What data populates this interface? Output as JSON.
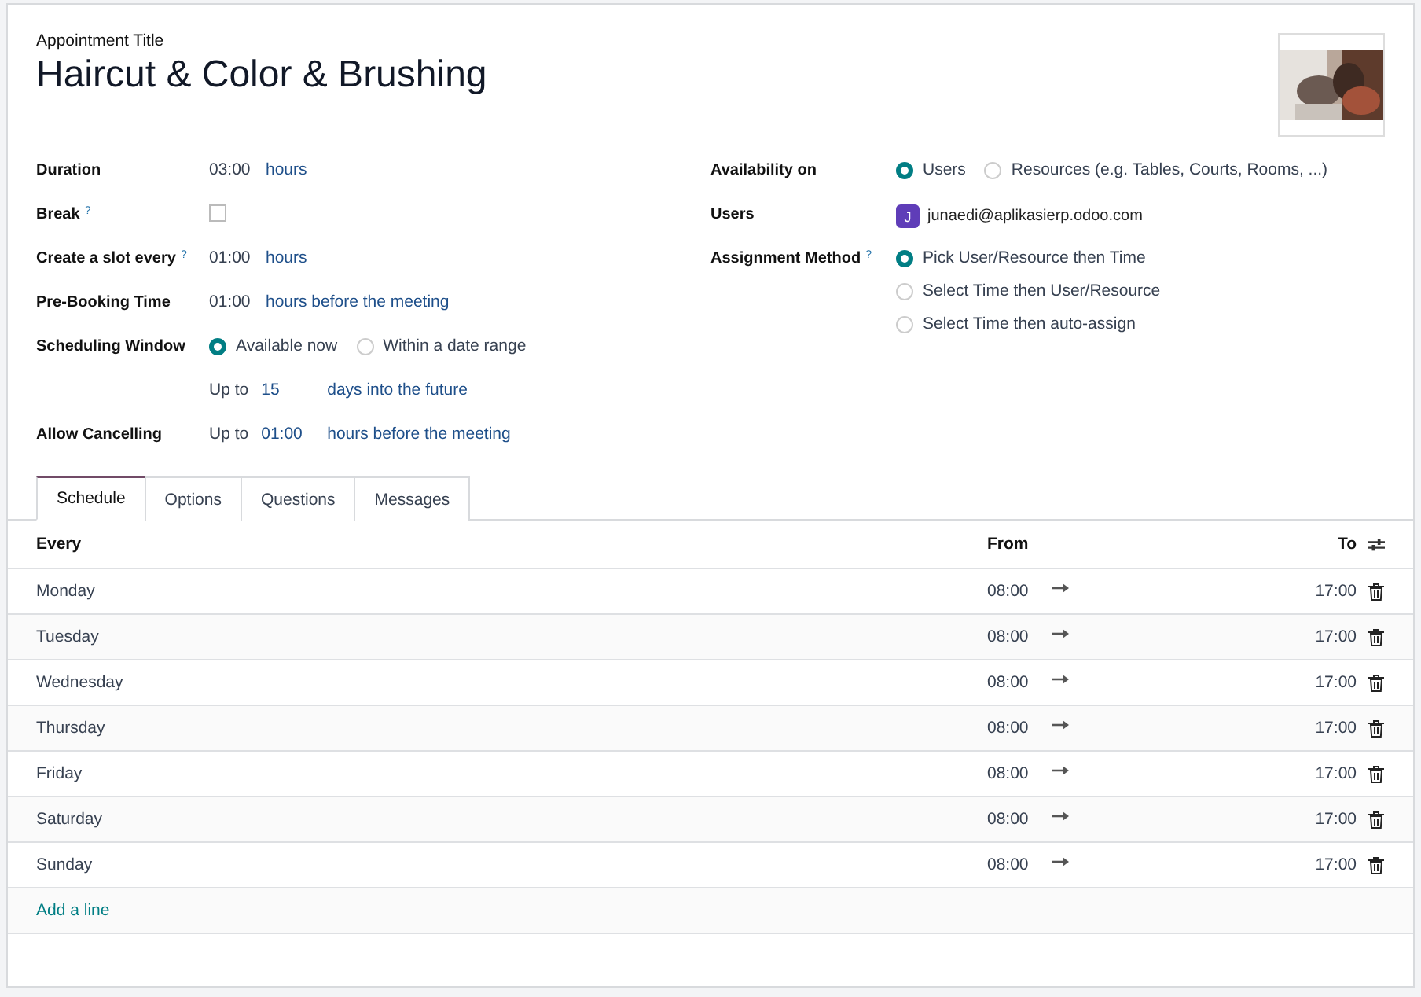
{
  "title_label": "Appointment Title",
  "title": "Haircut & Color & Brushing",
  "left_fields": [
    {
      "kind": "duration",
      "label": "Duration",
      "value": "03:00",
      "unit": "hours"
    },
    {
      "kind": "checkbox",
      "label": "Break",
      "help": "?",
      "checked": false
    },
    {
      "kind": "duration",
      "label": "Create a slot every",
      "help": "?",
      "value": "01:00",
      "unit": "hours"
    },
    {
      "kind": "duration",
      "label": "Pre-Booking Time",
      "value": "01:00",
      "unit": "hours before the meeting"
    },
    {
      "kind": "radio",
      "label": "Scheduling Window",
      "options": [
        {
          "label": "Available now",
          "selected": true
        },
        {
          "label": "Within a date range",
          "selected": false
        }
      ]
    },
    {
      "kind": "upto",
      "prefix": "Up to",
      "value": "15",
      "unit": "days into the future"
    },
    {
      "kind": "upto",
      "label": "Allow Cancelling",
      "prefix": "Up to",
      "value": "01:00",
      "unit": "hours before the meeting"
    }
  ],
  "right_fields": [
    {
      "kind": "radio",
      "label": "Availability on",
      "options": [
        {
          "label": "Users",
          "selected": true
        },
        {
          "label": "Resources (e.g. Tables, Courts, Rooms, ...)",
          "selected": false
        }
      ]
    },
    {
      "kind": "user",
      "label": "Users",
      "initial": "J",
      "email": "junaedi@aplikasierp.odoo.com",
      "color": "#5f3db8"
    },
    {
      "kind": "radio_stack",
      "label": "Assignment Method",
      "help": "?",
      "options": [
        {
          "label": "Pick User/Resource then Time",
          "selected": true
        },
        {
          "label": "Select Time then User/Resource",
          "selected": false
        },
        {
          "label": "Select Time then auto-assign",
          "selected": false
        }
      ]
    }
  ],
  "tabs": [
    {
      "label": "Schedule",
      "selected": true
    },
    {
      "label": "Options",
      "selected": false
    },
    {
      "label": "Questions",
      "selected": false
    },
    {
      "label": "Messages",
      "selected": false
    }
  ],
  "table": {
    "columns": [
      "Every",
      "From",
      "To"
    ],
    "rows": [
      {
        "day": "Monday",
        "from": "08:00",
        "to": "17:00"
      },
      {
        "day": "Tuesday",
        "from": "08:00",
        "to": "17:00"
      },
      {
        "day": "Wednesday",
        "from": "08:00",
        "to": "17:00"
      },
      {
        "day": "Thursday",
        "from": "08:00",
        "to": "17:00"
      },
      {
        "day": "Friday",
        "from": "08:00",
        "to": "17:00"
      },
      {
        "day": "Saturday",
        "from": "08:00",
        "to": "17:00"
      },
      {
        "day": "Sunday",
        "from": "08:00",
        "to": "17:00"
      }
    ],
    "add_line": "Add a line"
  }
}
